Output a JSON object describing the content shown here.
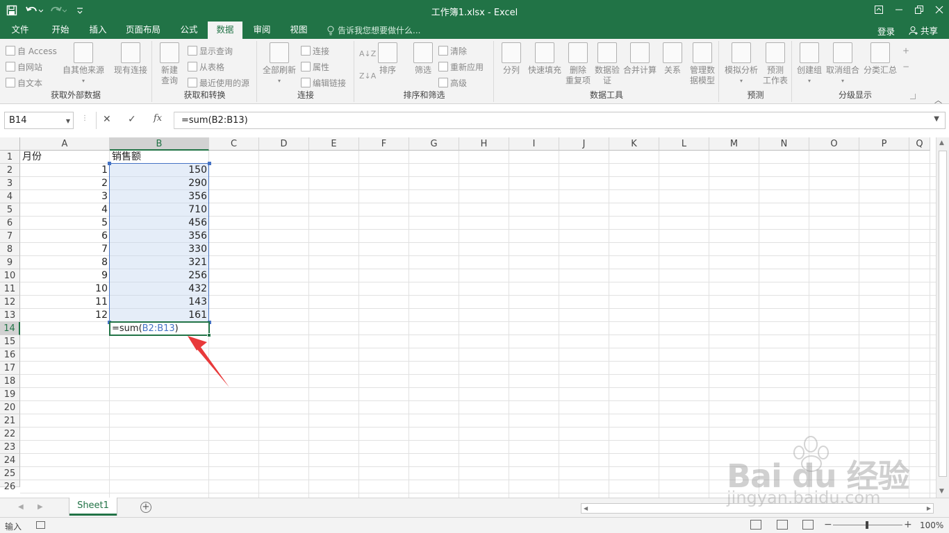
{
  "window": {
    "title": "工作簿1.xlsx - Excel",
    "controls": [
      "restore-ribbon-icon",
      "minimize-icon",
      "restore-icon",
      "close-icon"
    ]
  },
  "qat": {
    "save": "save-icon",
    "undo": "undo-icon",
    "redo": "redo-icon",
    "customize": "customize-icon"
  },
  "tabs": [
    {
      "label": "文件"
    },
    {
      "label": "开始"
    },
    {
      "label": "插入"
    },
    {
      "label": "页面布局"
    },
    {
      "label": "公式"
    },
    {
      "label": "数据",
      "active": true
    },
    {
      "label": "审阅"
    },
    {
      "label": "视图"
    }
  ],
  "tellme": "告诉我您想要做什么...",
  "account": {
    "login": "登录",
    "share": "共享"
  },
  "ribbon": {
    "groups": [
      {
        "label": "获取外部数据"
      },
      {
        "label": "获取和转换"
      },
      {
        "label": "连接"
      },
      {
        "label": "排序和筛选"
      },
      {
        "label": "数据工具"
      },
      {
        "label": "预测"
      },
      {
        "label": "分级显示"
      }
    ],
    "external": {
      "access": "自 Access",
      "web": "自网站",
      "text": "自文本",
      "other_line1": "自其他来源",
      "existing": "现有连接"
    },
    "transform": {
      "new_query_line1": "新建",
      "new_query_line2": "查询",
      "show_queries": "显示查询",
      "from_table": "从表格",
      "recent_sources": "最近使用的源"
    },
    "connections": {
      "refresh_all": "全部刷新",
      "connections": "连接",
      "properties": "属性",
      "edit_links": "编辑链接"
    },
    "sort_filter": {
      "sort": "排序",
      "filter": "筛选",
      "clear": "清除",
      "reapply": "重新应用",
      "advanced": "高级"
    },
    "data_tools": {
      "text_to_columns": "分列",
      "flash_fill": "快速填充",
      "remove_dup_line1": "删除",
      "remove_dup_line2": "重复项",
      "validation_line1": "数据验",
      "validation_line2": "证",
      "consolidate": "合并计算",
      "relationships": "关系",
      "manage_model_line1": "管理数",
      "manage_model_line2": "据模型"
    },
    "forecast": {
      "whatif": "模拟分析",
      "sheet_line1": "预测",
      "sheet_line2": "工作表"
    },
    "outline": {
      "group": "创建组",
      "ungroup": "取消组合",
      "subtotal": "分类汇总"
    }
  },
  "formula_bar": {
    "name_box": "B14",
    "formula": "=sum(B2:B13)",
    "cancel": "✕",
    "enter": "✓",
    "fx": "fx"
  },
  "columns": [
    "A",
    "B",
    "C",
    "D",
    "E",
    "F",
    "G",
    "H",
    "I",
    "J",
    "K",
    "L",
    "M",
    "N",
    "O",
    "P",
    "Q"
  ],
  "rows": [
    "1",
    "2",
    "3",
    "4",
    "5",
    "6",
    "7",
    "8",
    "9",
    "10",
    "11",
    "12",
    "13",
    "14",
    "15",
    "16",
    "17",
    "18",
    "19",
    "20",
    "21",
    "22",
    "23",
    "24",
    "25",
    "26"
  ],
  "sheet": {
    "headers": {
      "month": "月份",
      "sales": "销售额"
    },
    "data": [
      {
        "month": "1",
        "sales": "150"
      },
      {
        "month": "2",
        "sales": "290"
      },
      {
        "month": "3",
        "sales": "356"
      },
      {
        "month": "4",
        "sales": "710"
      },
      {
        "month": "5",
        "sales": "456"
      },
      {
        "month": "6",
        "sales": "356"
      },
      {
        "month": "7",
        "sales": "330"
      },
      {
        "month": "8",
        "sales": "321"
      },
      {
        "month": "9",
        "sales": "256"
      },
      {
        "month": "10",
        "sales": "432"
      },
      {
        "month": "11",
        "sales": "143"
      },
      {
        "month": "12",
        "sales": "161"
      }
    ],
    "editing_cell": {
      "ref": "B14",
      "fn_part": "=sum(",
      "range_part": "B2:B13",
      "close": ")"
    },
    "selected_column": "B",
    "selected_row": "14"
  },
  "sheet_tabs": [
    {
      "label": "Sheet1",
      "active": true
    }
  ],
  "status": {
    "mode": "输入",
    "zoom": "100%"
  },
  "watermark": {
    "logo": "Bai du 经验",
    "url": "jingyan.baidu.com"
  },
  "annotation": {
    "arrow_color": "#e8393a"
  }
}
